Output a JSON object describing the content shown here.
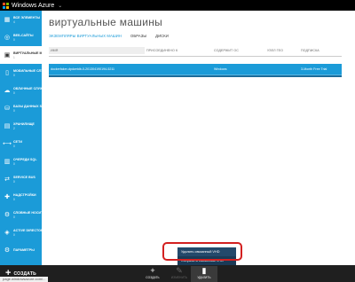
{
  "topbar": {
    "brand": "Windows Azure"
  },
  "sidebar": {
    "items": [
      {
        "label": "ВСЕ ЭЛЕМЕНТЫ",
        "count": "4",
        "icon": "grid-icon",
        "glyph": "▦"
      },
      {
        "label": "ВЕБ-САЙТЫ",
        "count": "0",
        "icon": "globe-icon",
        "glyph": "◎"
      },
      {
        "label": "ВИРТУАЛЬНЫЕ МАШИНЫ",
        "count": "1",
        "icon": "monitor-icon",
        "glyph": "▣"
      },
      {
        "label": "МОБИЛЬНЫЕ СЛУЖБЫ",
        "count": "0",
        "icon": "mobile-icon",
        "glyph": "▯"
      },
      {
        "label": "ОБЛАЧНЫЕ СЛУЖБЫ",
        "count": "0",
        "icon": "cloud-icon",
        "glyph": "☁"
      },
      {
        "label": "БАЗЫ ДАННЫХ SQL",
        "count": "0",
        "icon": "database-icon",
        "glyph": "⛁"
      },
      {
        "label": "ХРАНИЛИЩЕ",
        "count": "2",
        "icon": "storage-icon",
        "glyph": "▤"
      },
      {
        "label": "СЕТИ",
        "count": "0",
        "icon": "network-icon",
        "glyph": "⟷"
      },
      {
        "label": "ОЧЕРЕДИ SQL",
        "count": "0",
        "icon": "queue-icon",
        "glyph": "▥"
      },
      {
        "label": "SERVICE BUS",
        "count": "0",
        "icon": "service-bus-icon",
        "glyph": "⇄"
      },
      {
        "label": "НАДСТРОЙКИ",
        "count": "0",
        "icon": "addons-icon",
        "glyph": "✚"
      },
      {
        "label": "СЛОВНЫЕ НОСИТЕЛЕЙ",
        "count": "0",
        "icon": "media-icon",
        "glyph": "⚙"
      },
      {
        "label": "ACTIVE DIRECTORY",
        "count": "0",
        "icon": "directory-icon",
        "glyph": "◈"
      },
      {
        "label": "ПАРАМЕТРЫ",
        "count": "",
        "icon": "settings-icon",
        "glyph": "⚙"
      }
    ]
  },
  "main": {
    "title": "виртуальные машины",
    "tabs": [
      {
        "label": "ЭКЗЕМПЛЯРЫ ВИРТУАЛЬНЫХ МАШИН"
      },
      {
        "label": "ОБРАЗЫ"
      },
      {
        "label": "ДИСКИ"
      }
    ],
    "columns": [
      "ИМЯ",
      "ПРИСОЕДИНЕНО К",
      "СОДЕРЖИТ ОС",
      "УЗЕЛ ГЕО",
      "ПОДПИСКА"
    ],
    "rows": [
      {
        "name": "dockerfaker-dpdwrtdb-0-201304190194-5211",
        "attached": "",
        "os": "Windows",
        "geo": "",
        "subscription": "3-Month Free Trial"
      }
    ]
  },
  "popup": {
    "items": [
      "Удалить связанный VHD",
      "Сохранить связанный VHD"
    ]
  },
  "cmdbar": {
    "new_label": "СОЗДАТЬ",
    "commands": [
      {
        "label": "СОЗДАТЬ",
        "glyph": "+"
      },
      {
        "label": "ИЗМЕНИТЬ",
        "glyph": "✎"
      },
      {
        "label": "УДАЛИТЬ",
        "glyph": "🗑"
      }
    ]
  },
  "status": {
    "url": "page.windowsazure.com/..."
  },
  "colors": {
    "accent": "#1b9bd8",
    "topbar": "#000000",
    "cmdbar": "#1f1f1f",
    "highlight": "#d32020"
  }
}
